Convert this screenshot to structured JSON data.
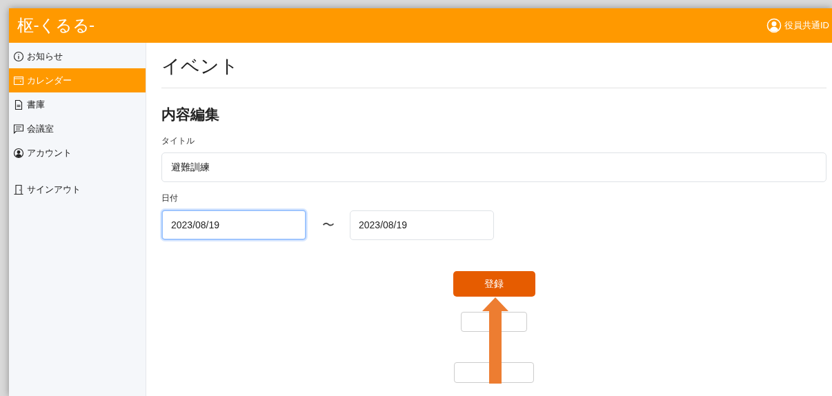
{
  "header": {
    "logo": "枢-くるる-",
    "user": "役員共通ID"
  },
  "sidebar": {
    "items": [
      {
        "kind": "info",
        "label": "お知らせ",
        "selected": false
      },
      {
        "kind": "calendar",
        "label": "カレンダー",
        "selected": true
      },
      {
        "kind": "document",
        "label": "書庫",
        "selected": false
      },
      {
        "kind": "chat",
        "label": "会議室",
        "selected": false
      },
      {
        "kind": "account",
        "label": "アカウント",
        "selected": false
      },
      {
        "kind": "signout",
        "label": "サインアウト",
        "selected": false
      }
    ]
  },
  "page": {
    "title": "イベント",
    "section": "内容編集",
    "title_field": {
      "label": "タイトル",
      "value": "避難訓練"
    },
    "date_field": {
      "label": "日付",
      "from": "2023/08/19",
      "separator": "〜",
      "to": "2023/08/19",
      "from_focused": true
    },
    "buttons": [
      {
        "kind": "primary",
        "label": "登録"
      },
      {
        "kind": "secondary"
      },
      {
        "kind": "secondary"
      }
    ]
  }
}
